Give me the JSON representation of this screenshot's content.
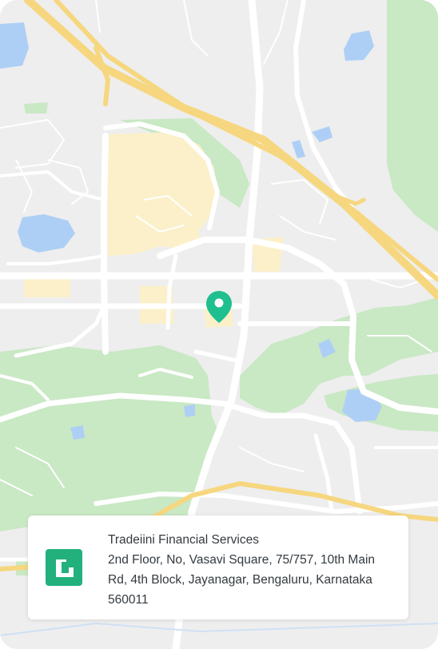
{
  "location_card": {
    "company_name": "Tradeiini Financial Services",
    "address_lines": [
      "2nd Floor, No, Vasavi Square, 75/757, 10th Main",
      "Rd, 4th Block, Jayanagar, Bengaluru, Karnataka",
      "560011"
    ]
  },
  "map": {
    "marker_icon": "location-pin-icon",
    "marker_color": "#1fbf8f",
    "brand_logo_icon": "brand-logo-icon",
    "brand_color": "#22b07d",
    "land_color": "#eeeeee",
    "park_color": "#c9e8c4",
    "water_color": "#aecff5",
    "highway_color": "#f6d77f",
    "urban_area_color": "#fbf0c9"
  }
}
